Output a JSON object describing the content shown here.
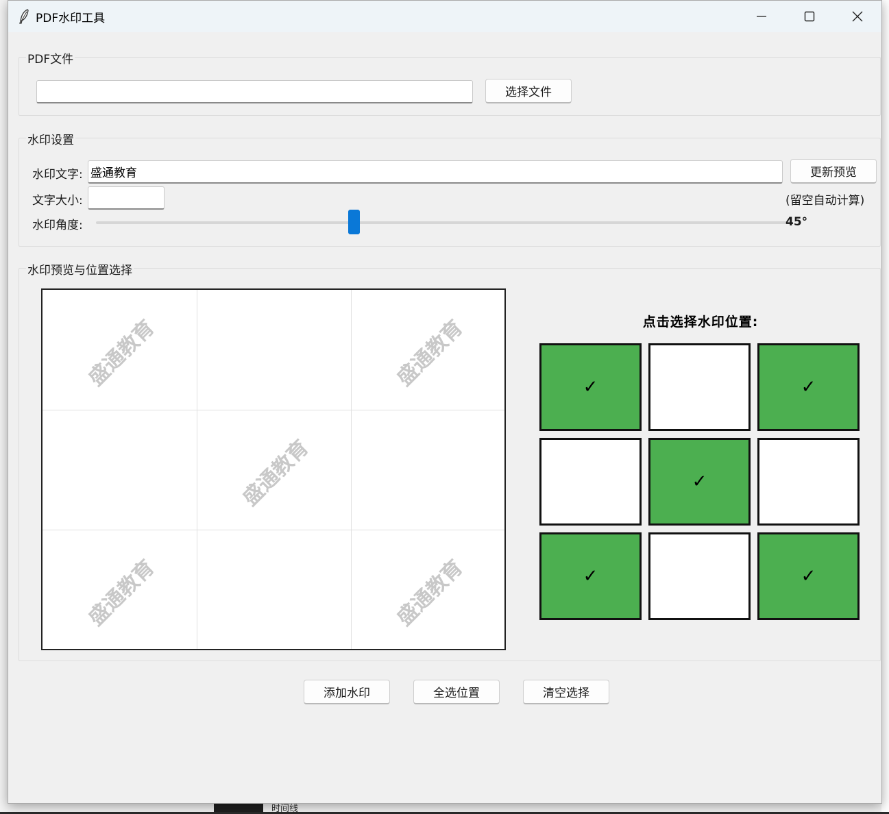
{
  "window": {
    "title": "PDF水印工具"
  },
  "background": {
    "taskbar_text": "时间线"
  },
  "pdf_group": {
    "label": "PDF文件",
    "file_path": "",
    "select_button": "选择文件"
  },
  "settings_group": {
    "label": "水印设置",
    "text_label": "水印文字:",
    "text_value": "盛通教育",
    "update_button": "更新预览",
    "size_label": "文字大小:",
    "size_value": "",
    "size_hint": "(留空自动计算)",
    "angle_label": "水印角度:",
    "angle_value": 45,
    "angle_display": "45°",
    "angle_range": [
      0,
      90
    ]
  },
  "preview_group": {
    "label": "水印预览与位置选择",
    "watermark_text": "盛通教育",
    "position_title": "点击选择水印位置:",
    "check_mark": "✓",
    "positions": [
      true,
      false,
      true,
      false,
      true,
      false,
      true,
      false,
      true
    ]
  },
  "actions": {
    "add": "添加水印",
    "select_all": "全选位置",
    "clear": "清空选择"
  },
  "colors": {
    "selected": "#4caf50",
    "unselected": "#ffffff",
    "slider": "#0a78d7",
    "watermark": "#c8c8c8"
  }
}
